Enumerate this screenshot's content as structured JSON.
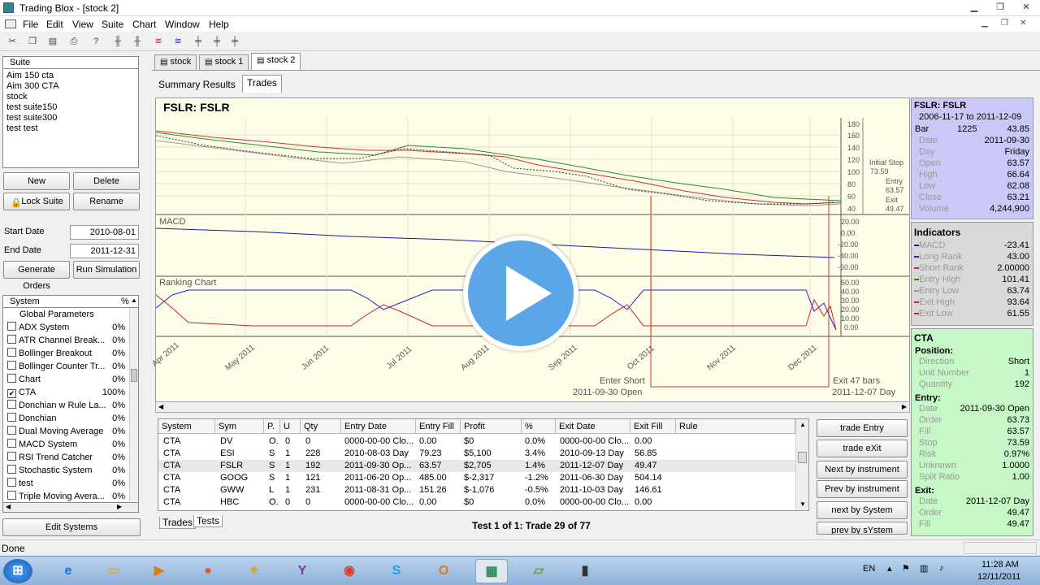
{
  "window": {
    "title": "Trading Blox - [stock 2]"
  },
  "menu": [
    "File",
    "Edit",
    "View",
    "Suite",
    "Chart",
    "Window",
    "Help"
  ],
  "sidebar": {
    "suite_header": "Suite",
    "suites": [
      "Aim 150 cta",
      "Aim 300 CTA",
      "stock",
      "test suite150",
      "test suite300",
      "test test"
    ],
    "new_label": "New",
    "delete_label": "Delete",
    "lock_label": "Lock Suite",
    "rename_label": "Rename",
    "start_label": "Start Date",
    "start_value": "2010-08-01",
    "end_label": "End Date",
    "end_value": "2011-12-31",
    "generate_label": "Generate Orders",
    "run_label": "Run Simulation",
    "system_header": "System",
    "pct_header": "%",
    "global_params": "Global Parameters",
    "systems": [
      {
        "name": "ADX System",
        "pct": "0%",
        "checked": false
      },
      {
        "name": "ATR Channel Break...",
        "pct": "0%",
        "checked": false
      },
      {
        "name": "Bollinger Breakout",
        "pct": "0%",
        "checked": false
      },
      {
        "name": "Bollinger Counter Tr...",
        "pct": "0%",
        "checked": false
      },
      {
        "name": "Chart",
        "pct": "0%",
        "checked": false
      },
      {
        "name": "CTA",
        "pct": "100%",
        "checked": true
      },
      {
        "name": "Donchian w Rule La...",
        "pct": "0%",
        "checked": false
      },
      {
        "name": "Donchian",
        "pct": "0%",
        "checked": false
      },
      {
        "name": "Dual Moving Average",
        "pct": "0%",
        "checked": false
      },
      {
        "name": "MACD System",
        "pct": "0%",
        "checked": false
      },
      {
        "name": "RSI Trend Catcher",
        "pct": "0%",
        "checked": false
      },
      {
        "name": "Stochastic System",
        "pct": "0%",
        "checked": false
      },
      {
        "name": "test",
        "pct": "0%",
        "checked": false
      },
      {
        "name": "Triple Moving Avera...",
        "pct": "0%",
        "checked": false
      }
    ],
    "edit_systems_label": "Edit Systems"
  },
  "doc_tabs": [
    "stock",
    "stock 1",
    "stock 2"
  ],
  "sub_tabs": {
    "summary": "Summary Results",
    "trades": "Trades"
  },
  "chart": {
    "title": "FSLR: FSLR",
    "macd_label": "MACD",
    "ranking_label": "Ranking Chart",
    "price_ticks": [
      "180",
      "160",
      "140",
      "120",
      "100",
      "80",
      "60",
      "40"
    ],
    "macd_ticks": [
      "20.00",
      "0.00",
      "-20.00",
      "-40.00",
      "-60.00"
    ],
    "rank_ticks": [
      "50.00",
      "40.00",
      "30.00",
      "20.00",
      "10.00",
      "0.00"
    ],
    "date_ticks": [
      "Apr 2011",
      "May 2011",
      "Jun 2011",
      "Jul 2011",
      "Aug 2011",
      "Sep 2011",
      "Oct 2011",
      "Nov 2011",
      "Dec 2011"
    ],
    "initial_stop_label": "Initial Stop",
    "initial_stop_value": "73.59",
    "entry_label": "Entry",
    "entry_value": "63.57",
    "exit_label": "Exit",
    "exit_value": "49.47",
    "enter_short": "Enter Short",
    "enter_date": "2011-09-30 Open",
    "exit_bars": "Exit 47 bars",
    "exit_date": "2011-12-07 Day"
  },
  "info": {
    "title": "FSLR: FSLR",
    "range": "2006-11-17 to 2011-12-09",
    "bar_label": "Bar",
    "bar_num": "1225",
    "bar_val": "43.85",
    "rows": [
      {
        "k": "Date",
        "v": "2011-09-30"
      },
      {
        "k": "Day",
        "v": "Friday"
      },
      {
        "k": "Open",
        "v": "63.57"
      },
      {
        "k": "High",
        "v": "66.64"
      },
      {
        "k": "Low",
        "v": "62.08"
      },
      {
        "k": "Close",
        "v": "63.21"
      },
      {
        "k": "Volume",
        "v": "4,244,900"
      }
    ],
    "indicators_title": "Indicators",
    "indicators": [
      {
        "k": "MACD",
        "v": "-23.41",
        "color": "#1a1aa0"
      },
      {
        "k": "Long Rank",
        "v": "43.00",
        "color": "#2222dd"
      },
      {
        "k": "Short Rank",
        "v": "2.00000",
        "color": "#cc2222"
      },
      {
        "k": "Entry High",
        "v": "101.41",
        "color": "#228822"
      },
      {
        "k": "Entry Low",
        "v": "63.74",
        "color": "#999999"
      },
      {
        "k": "Exit High",
        "v": "93.64",
        "color": "#cc2222"
      },
      {
        "k": "Exit Low",
        "v": "61.55",
        "color": "#cc2222"
      }
    ],
    "cta_title": "CTA",
    "position_title": "Position:",
    "position": [
      {
        "k": "Direction",
        "v": "Short"
      },
      {
        "k": "Unit Number",
        "v": "1"
      },
      {
        "k": "Quantity",
        "v": "192"
      }
    ],
    "entry_title": "Entry:",
    "entry": [
      {
        "k": "Date",
        "v": "2011-09-30 Open"
      },
      {
        "k": "Order",
        "v": "63.73"
      },
      {
        "k": "Fill",
        "v": "63.57"
      },
      {
        "k": "Stop",
        "v": "73.59"
      },
      {
        "k": "Risk",
        "v": "0.97%"
      },
      {
        "k": "Unknown",
        "v": "1.0000"
      },
      {
        "k": "Split Ratio",
        "v": "1.00"
      }
    ],
    "exit_title": "Exit:",
    "exit": [
      {
        "k": "Date",
        "v": "2011-12-07 Day"
      },
      {
        "k": "Order",
        "v": "49.47"
      },
      {
        "k": "Fill",
        "v": "49.47"
      }
    ]
  },
  "trades": {
    "headers": [
      "System",
      "Sym",
      "P.",
      "U",
      "Qty",
      "Entry Date",
      "Entry Fill",
      "Profit",
      "%",
      "Exit Date",
      "Exit Fill",
      "Rule"
    ],
    "rows": [
      [
        "CTA",
        "DV",
        "O.",
        "0",
        "0",
        "0000-00-00 Clo...",
        "0.00",
        "$0",
        "0.0%",
        "0000-00-00 Clo...",
        "0.00",
        ""
      ],
      [
        "CTA",
        "ESI",
        "S",
        "1",
        "228",
        "2010-08-03 Day",
        "79.23",
        "$5,100",
        "3.4%",
        "2010-09-13 Day",
        "56.85",
        ""
      ],
      [
        "CTA",
        "FSLR",
        "S",
        "1",
        "192",
        "2011-09-30 Op...",
        "63.57",
        "$2,705",
        "1.4%",
        "2011-12-07 Day",
        "49.47",
        ""
      ],
      [
        "CTA",
        "GOOG",
        "S",
        "1",
        "121",
        "2011-06-20 Op...",
        "485.00",
        "$-2,317",
        "-1.2%",
        "2011-06-30 Day",
        "504.14",
        ""
      ],
      [
        "CTA",
        "GWW",
        "L",
        "1",
        "231",
        "2011-08-31 Op...",
        "151.26",
        "$-1,076",
        "-0.5%",
        "2011-10-03 Day",
        "146.61",
        ""
      ],
      [
        "CTA",
        "HBC",
        "O.",
        "0",
        "0",
        "0000-00-00 Clo...",
        "0.00",
        "$0",
        "0.0%",
        "0000-00-00 Clo...",
        "0.00",
        ""
      ]
    ],
    "bottom_tabs": [
      "Trades",
      "Tests"
    ],
    "footer": "Test 1 of 1: Trade 29 of 77"
  },
  "nav": {
    "trade_entry": "trade Entry",
    "trade_exit": "trade eXit",
    "next_instr": "Next by instrument",
    "prev_instr": "Prev by instrument",
    "next_system": "next by System",
    "prev_system": "prev by sYstem"
  },
  "status": {
    "text": "Done"
  },
  "taskbar": {
    "lang": "EN",
    "time": "11:28 AM",
    "date": "12/11/2011"
  }
}
